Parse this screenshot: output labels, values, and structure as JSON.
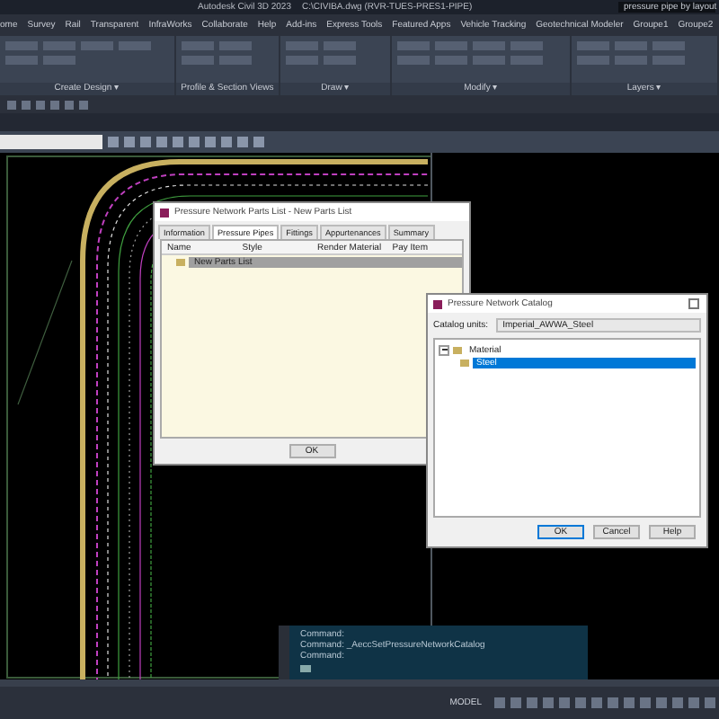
{
  "window": {
    "title": "Autodesk Civil 3D 2023",
    "file": "C:\\CIVIBA.dwg (RVR-TUES-PRES1-PIPE)"
  },
  "search": {
    "value": "pressure pipe by layout"
  },
  "ribbon_tabs": [
    {
      "label": "ome",
      "selected": false
    },
    {
      "label": "Survey",
      "selected": false
    },
    {
      "label": "Rail",
      "selected": false
    },
    {
      "label": "Transparent",
      "selected": false
    },
    {
      "label": "InfraWorks",
      "selected": false
    },
    {
      "label": "Collaborate",
      "selected": false
    },
    {
      "label": "Help",
      "selected": false
    },
    {
      "label": "Add-ins",
      "selected": false
    },
    {
      "label": "Express Tools",
      "selected": false
    },
    {
      "label": "Featured Apps",
      "selected": false
    },
    {
      "label": "Vehicle Tracking",
      "selected": false
    },
    {
      "label": "Geotechnical Modeler",
      "selected": false
    },
    {
      "label": "Groupe1",
      "selected": false
    },
    {
      "label": "Groupe2",
      "selected": false
    }
  ],
  "ribbon_panels": [
    {
      "label": "Create Design ▾"
    },
    {
      "label": "Profile & Section Views"
    },
    {
      "label": "Draw ▾"
    },
    {
      "label": "Modify ▾"
    },
    {
      "label": "Layers ▾"
    }
  ],
  "parts_list_dialog": {
    "title": "Pressure Network Parts List - New Parts List",
    "tabs": [
      {
        "label": "Information",
        "selected": false
      },
      {
        "label": "Pressure Pipes",
        "selected": true
      },
      {
        "label": "Fittings",
        "selected": false
      },
      {
        "label": "Appurtenances",
        "selected": false
      },
      {
        "label": "Summary",
        "selected": false
      }
    ],
    "columns": [
      "Name",
      "Style",
      "Render Material",
      "Pay Item"
    ],
    "rows": [
      {
        "name": "New Parts List",
        "selected": true
      }
    ],
    "buttons": [
      "OK"
    ]
  },
  "catalog_dialog": {
    "title": "Pressure Network Catalog",
    "catalog_units_label": "Catalog units:",
    "catalog_units": "Imperial_AWWA_Steel",
    "tree": [
      {
        "label": "Material",
        "expanded": true,
        "selected": false,
        "children": [
          {
            "label": "Steel",
            "selected": true
          }
        ]
      }
    ],
    "buttons": [
      "OK",
      "Cancel",
      "Help"
    ]
  },
  "command_line": {
    "lines": [
      "Command:",
      "Command:  _AeccSetPressureNetworkCatalog",
      "Command:"
    ]
  },
  "status_bar": {
    "mode": "MODEL"
  }
}
